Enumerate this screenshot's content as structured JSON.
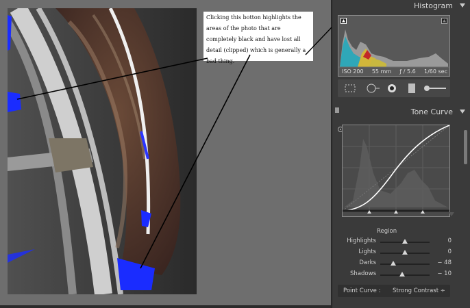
{
  "annotation": {
    "text": "Clicking this botton highlights the areas of the photo that are completely black and have lost all detail (clipped) which is generally a bad thing."
  },
  "histogram": {
    "title": "Histogram",
    "iso": "ISO 200",
    "focal": "55 mm",
    "aperture": "ƒ / 5.6",
    "shutter": "1/60 sec"
  },
  "tone_curve": {
    "title": "Tone Curve",
    "region_label": "Region",
    "sliders": [
      {
        "name": "Highlights",
        "value": "0",
        "level": 0.5
      },
      {
        "name": "Lights",
        "value": "0",
        "level": 0.5
      },
      {
        "name": "Darks",
        "value": "− 48",
        "level": 0.26
      },
      {
        "name": "Shadows",
        "value": "− 10",
        "level": 0.45
      }
    ],
    "point_curve_label": "Point Curve :",
    "point_curve_value": "Strong Contrast ÷"
  },
  "icons": [
    "clip-shadows-icon",
    "clip-highlights-icon",
    "crop-icon",
    "spot-removal-icon",
    "redeye-icon",
    "graduated-filter-icon",
    "adjustment-brush-icon",
    "targeted-adjust-icon"
  ],
  "colors": {
    "clip_blue": "#1a2cff",
    "panel_bg": "#3a3a3a",
    "canvas_bg": "#6e6e6e"
  }
}
